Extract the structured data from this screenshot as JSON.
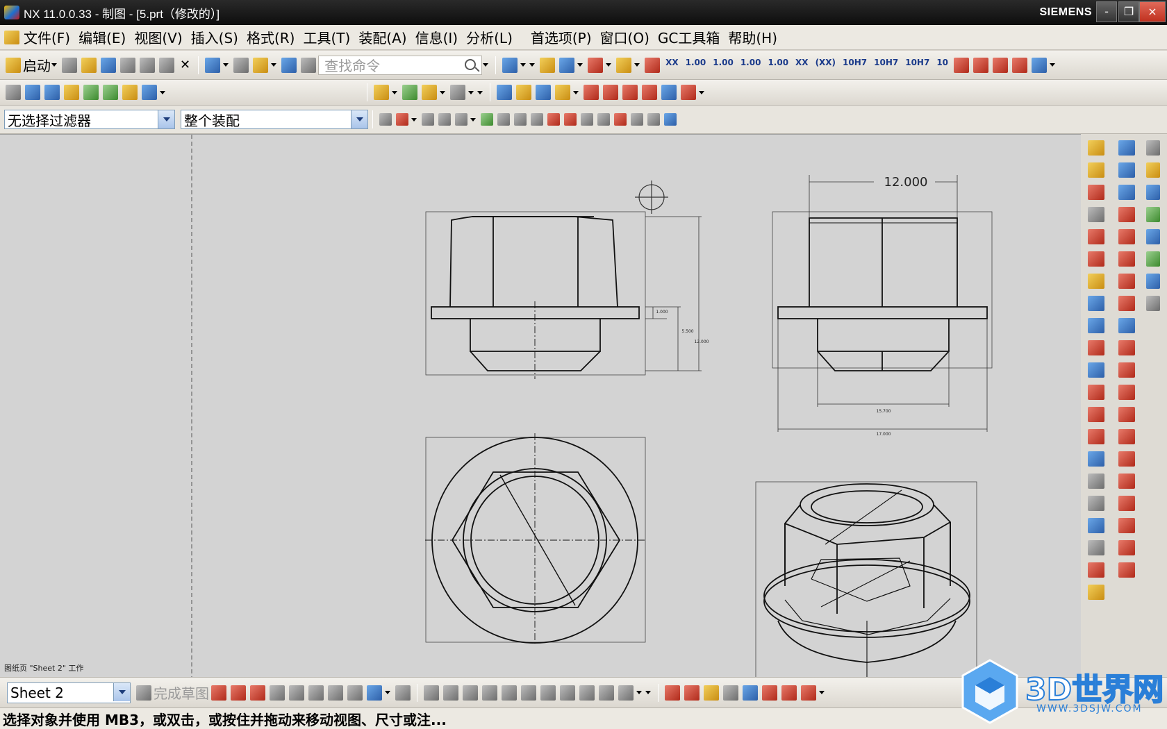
{
  "window": {
    "title": "NX 11.0.0.33 - 制图 - [5.prt（修改的）]",
    "brand": "SIEMENS",
    "min": "-",
    "restore": "❐",
    "close": "×"
  },
  "menu": [
    "文件(F)",
    "编辑(E)",
    "视图(V)",
    "插入(S)",
    "格式(R)",
    "工具(T)",
    "装配(A)",
    "信息(I)",
    "分析(L)",
    "首选项(P)",
    "窗口(O)",
    "GC工具箱",
    "帮助(H)"
  ],
  "toolbar1": {
    "start_label": "启动",
    "search_placeholder": "查找命令",
    "tol_labels": [
      "XX",
      "1.00",
      "1.00",
      "1.00",
      "1.00",
      "XX",
      "(XX)",
      "10H7",
      "10H7",
      "10H7",
      "10"
    ]
  },
  "selection": {
    "filter": "无选择过滤器",
    "scope": "整个装配"
  },
  "canvas": {
    "sheet_status": "图纸页 \"Sheet 2\" 工作",
    "dim_top": "12.000",
    "dim_1": "1.000",
    "dim_2": "5.500",
    "dim_3": "12.000",
    "dim_4": "15.700",
    "dim_5": "17.000"
  },
  "bottom": {
    "sheet": "Sheet 2",
    "finish_sketch": "完成草图"
  },
  "status": "选择对象并使用 MB3，或双击，或按住并拖动来移动视图、尺寸或注...",
  "watermark": {
    "name": "3D世界网",
    "url": "WWW.3DSJW.COM"
  }
}
